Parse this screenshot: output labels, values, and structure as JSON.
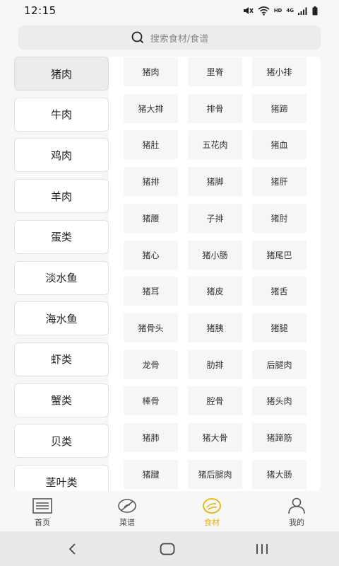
{
  "status": {
    "time": "12:15",
    "network": "HD",
    "signal_gen": "4G"
  },
  "search": {
    "placeholder": "搜索食材/食谱"
  },
  "categories": [
    {
      "label": "猪肉",
      "active": true
    },
    {
      "label": "牛肉",
      "active": false
    },
    {
      "label": "鸡肉",
      "active": false
    },
    {
      "label": "羊肉",
      "active": false
    },
    {
      "label": "蛋类",
      "active": false
    },
    {
      "label": "淡水鱼",
      "active": false
    },
    {
      "label": "海水鱼",
      "active": false
    },
    {
      "label": "虾类",
      "active": false
    },
    {
      "label": "蟹类",
      "active": false
    },
    {
      "label": "贝类",
      "active": false
    },
    {
      "label": "茎叶类",
      "active": false
    }
  ],
  "ingredients": [
    "猪肉",
    "里脊",
    "猪小排",
    "猪大排",
    "排骨",
    "猪蹄",
    "猪肚",
    "五花肉",
    "猪血",
    "猪排",
    "猪脚",
    "猪肝",
    "猪腰",
    "子排",
    "猪肘",
    "猪心",
    "猪小肠",
    "猪尾巴",
    "猪耳",
    "猪皮",
    "猪舌",
    "猪骨头",
    "猪胰",
    "猪腿",
    "龙骨",
    "肋排",
    "后腿肉",
    "棒骨",
    "腔骨",
    "猪头肉",
    "猪肺",
    "猪大骨",
    "猪蹄筋",
    "猪腱",
    "猪后腿肉",
    "猪大肠"
  ],
  "bottom_nav": [
    {
      "label": "首页",
      "icon": "home-icon",
      "active": false
    },
    {
      "label": "菜谱",
      "icon": "recipe-icon",
      "active": false
    },
    {
      "label": "食材",
      "icon": "ingredient-icon",
      "active": true
    },
    {
      "label": "我的",
      "icon": "profile-icon",
      "active": false
    }
  ],
  "colors": {
    "accent": "#e8b400",
    "background": "#f7f7f7",
    "card": "#ffffff",
    "tile": "#f6f6f6"
  }
}
